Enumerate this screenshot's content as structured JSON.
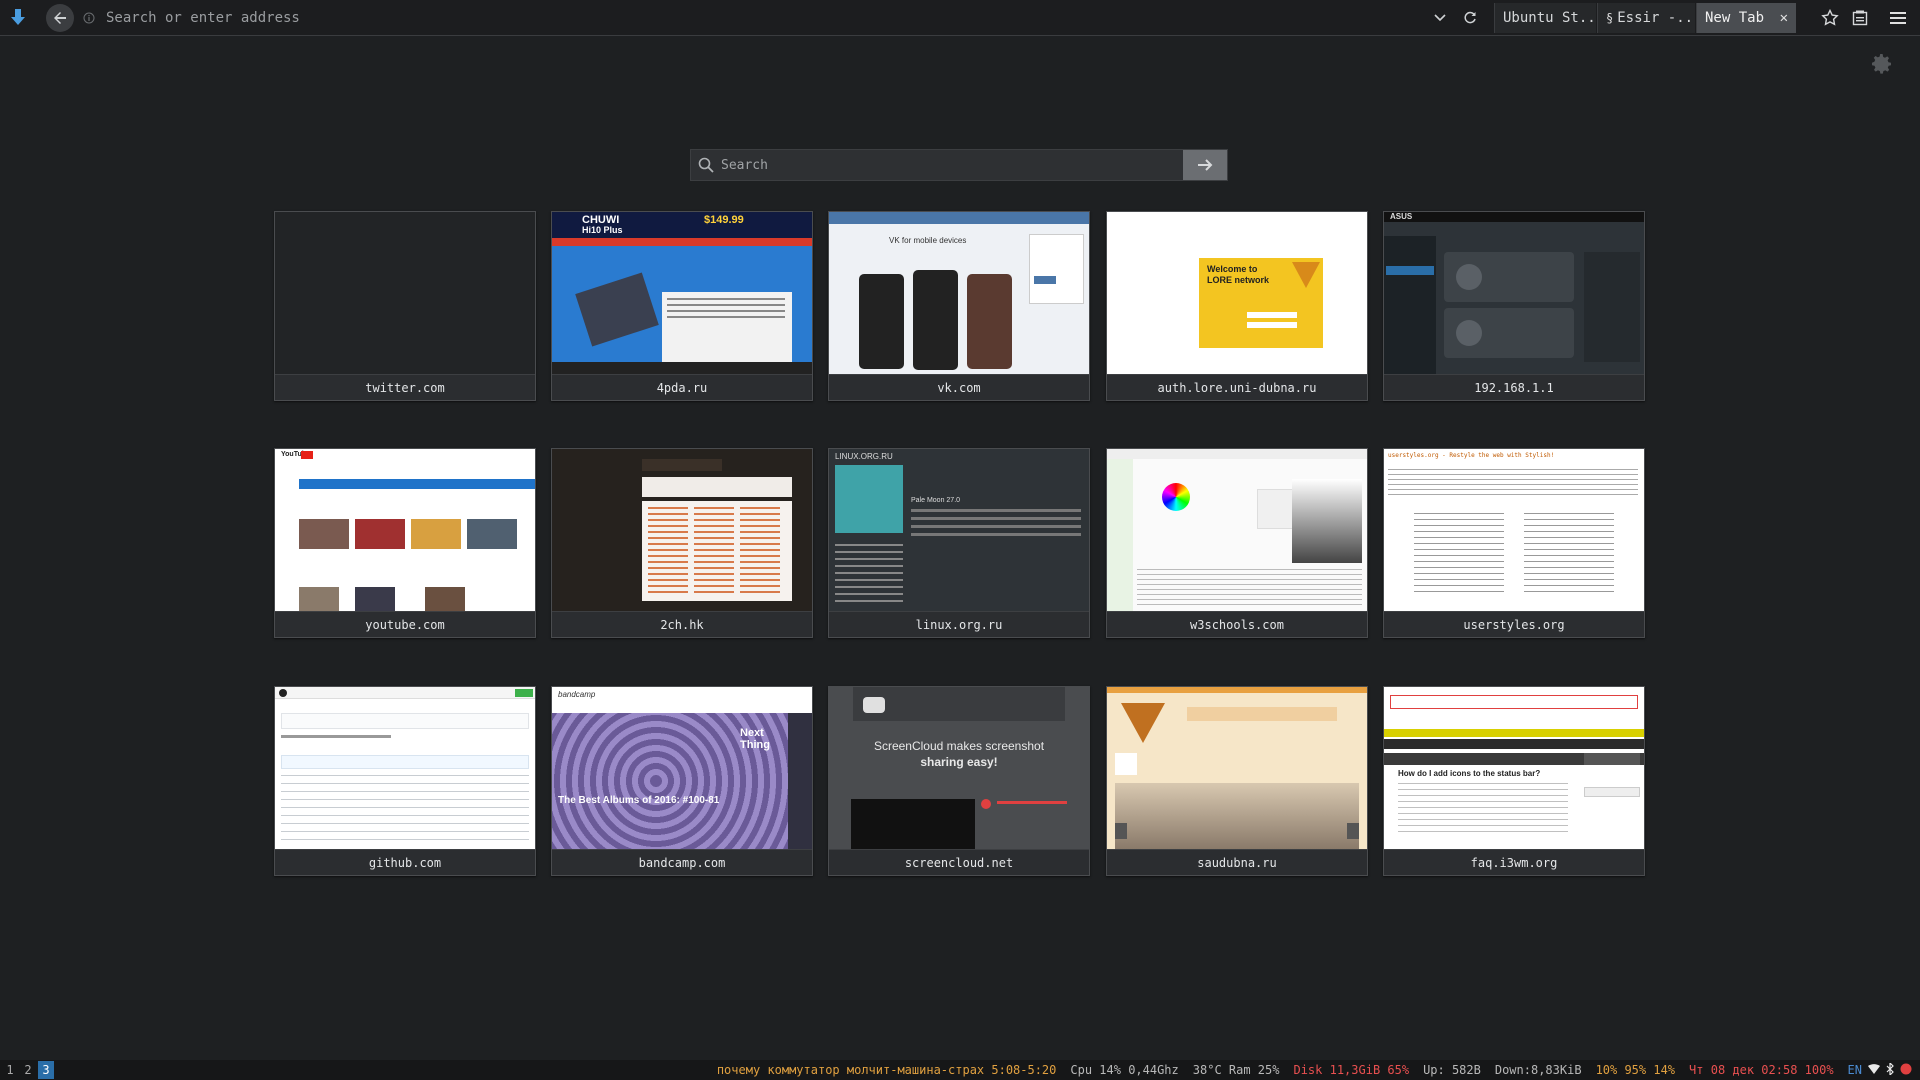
{
  "toolbar": {
    "url_placeholder": "Search or enter address",
    "tabs": [
      {
        "label": "Ubuntu St..."
      },
      {
        "label": "Essir -..."
      },
      {
        "label": "New Tab",
        "close": "✕"
      }
    ]
  },
  "search": {
    "placeholder": "Search"
  },
  "tiles": [
    {
      "label": "twitter.com"
    },
    {
      "label": "4pda.ru"
    },
    {
      "label": "vk.com"
    },
    {
      "label": "auth.lore.uni-dubna.ru"
    },
    {
      "label": "192.168.1.1"
    },
    {
      "label": "youtube.com"
    },
    {
      "label": "2ch.hk"
    },
    {
      "label": "linux.org.ru"
    },
    {
      "label": "w3schools.com"
    },
    {
      "label": "userstyles.org"
    },
    {
      "label": "github.com"
    },
    {
      "label": "bandcamp.com"
    },
    {
      "label": "screencloud.net"
    },
    {
      "label": "saudubna.ru"
    },
    {
      "label": "faq.i3wm.org"
    }
  ],
  "thumbs": {
    "chuwi": "CHUWI",
    "chuwi_model": "Hi10 Plus",
    "chuwi_price": "$149.99",
    "vk_title": "VK for mobile devices",
    "lore_title": "Welcome to\nLORE network",
    "asus": "ASUS",
    "youtube": "YouTube",
    "linux_title": "LINUX.ORG.RU",
    "linux_post": "Pale Moon 27.0",
    "userstyles": "userstyles.org - Restyle the web with Stylish!",
    "bandcamp_logo": "bandcamp",
    "bandcamp_title": "The Best Albums of 2016: #100-81",
    "bandcamp_next": "Next Thing",
    "screencloud_a": "ScreenCloud makes screenshot",
    "screencloud_b": "sharing easy!",
    "i3_question": "How do I add icons to the status bar?"
  },
  "status": {
    "workspaces": [
      "1",
      "2",
      "3"
    ],
    "active_workspace": "3",
    "song": "почему коммутатор молчит-машина-страх 5:08-5:20",
    "cpu": "Cpu 14% 0,44Ghz",
    "temp_ram": "38°C Ram 25%",
    "disk": "Disk 11,3GiB 65%",
    "up": "Up: 582B",
    "down": "Down:8,83KiB",
    "levels": "10% 95% 14%",
    "datetime": "Чт 08 дек 02:58 100%",
    "lang": "EN"
  },
  "colors": {
    "status_orange": "#e0a040",
    "status_red": "#e85050",
    "status_gray": "#b8b8b8",
    "accent_blue": "#2a6ea8"
  }
}
